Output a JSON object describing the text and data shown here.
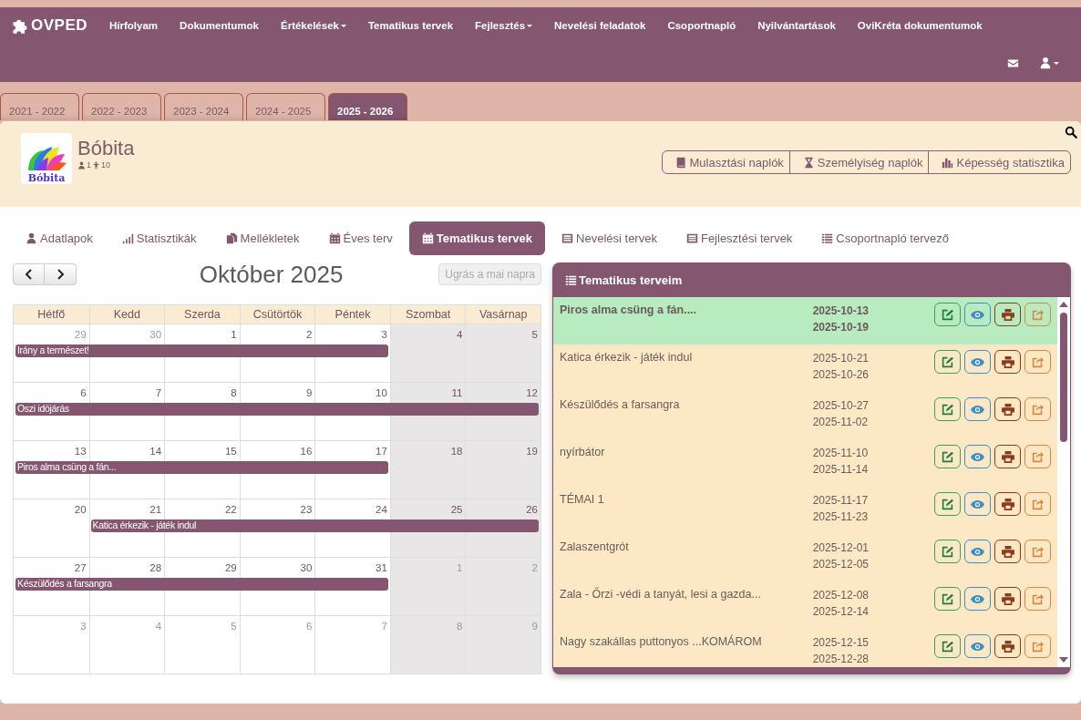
{
  "brand": "OVPED",
  "nav": [
    {
      "label": "Hírfolyam",
      "dropdown": false
    },
    {
      "label": "Dokumentumok",
      "dropdown": false
    },
    {
      "label": "Értékelések",
      "dropdown": true
    },
    {
      "label": "Tematikus tervek",
      "dropdown": false
    },
    {
      "label": "Fejlesztés",
      "dropdown": true
    },
    {
      "label": "Nevelési feladatok",
      "dropdown": false
    },
    {
      "label": "Csoportnapló",
      "dropdown": false
    },
    {
      "label": "Nyilvántartások",
      "dropdown": false
    },
    {
      "label": "OviKréta dokumentumok",
      "dropdown": false
    }
  ],
  "years": [
    {
      "label": "2021 - 2022",
      "selected": false
    },
    {
      "label": "2022 - 2023",
      "selected": false
    },
    {
      "label": "2023 - 2024",
      "selected": false
    },
    {
      "label": "2024 - 2025",
      "selected": false
    },
    {
      "label": "2025 - 2026",
      "selected": true
    }
  ],
  "group": {
    "name": "Bóbita",
    "logo_text": "Bóbita",
    "teachers": "1",
    "children": "10"
  },
  "header_buttons": [
    "Mulasztási naplók",
    "Személyiség naplók",
    "Képesség statisztika"
  ],
  "subtabs": [
    {
      "label": "Adatlapok",
      "selected": false
    },
    {
      "label": "Statisztikák",
      "selected": false
    },
    {
      "label": "Mellékletek",
      "selected": false
    },
    {
      "label": "Éves terv",
      "selected": false
    },
    {
      "label": "Tematikus tervek",
      "selected": true
    },
    {
      "label": "Nevelési tervek",
      "selected": false
    },
    {
      "label": "Fejlesztési tervek",
      "selected": false
    },
    {
      "label": "Csoportnapló tervező",
      "selected": false
    }
  ],
  "calendar": {
    "title": "Október 2025",
    "today_button": {
      "label": "Ugrás a mai napra",
      "disabled": true
    },
    "weekdays": [
      "Hétfő",
      "Kedd",
      "Szerda",
      "Csütörtök",
      "Péntek",
      "Szombat",
      "Vasárnap"
    ],
    "weeks": [
      {
        "days": [
          {
            "num": "29",
            "other": true
          },
          {
            "num": "30",
            "other": true
          },
          {
            "num": "1",
            "other": false
          },
          {
            "num": "2",
            "other": false
          },
          {
            "num": "3",
            "other": false
          },
          {
            "num": "4",
            "other": false
          },
          {
            "num": "5",
            "other": false
          }
        ],
        "event": {
          "title": "Irány a természet!"
        }
      },
      {
        "days": [
          {
            "num": "6",
            "other": false
          },
          {
            "num": "7",
            "other": false
          },
          {
            "num": "8",
            "other": false
          },
          {
            "num": "9",
            "other": false
          },
          {
            "num": "10",
            "other": false
          },
          {
            "num": "11",
            "other": false
          },
          {
            "num": "12",
            "other": false
          }
        ],
        "event": {
          "title": "Oszi idöjárás"
        }
      },
      {
        "days": [
          {
            "num": "13",
            "other": false
          },
          {
            "num": "14",
            "other": false
          },
          {
            "num": "15",
            "other": false
          },
          {
            "num": "16",
            "other": false
          },
          {
            "num": "17",
            "other": false
          },
          {
            "num": "18",
            "other": false
          },
          {
            "num": "19",
            "other": false
          }
        ],
        "event": {
          "title": "Piros alma csüng a fán..."
        }
      },
      {
        "days": [
          {
            "num": "20",
            "other": false
          },
          {
            "num": "21",
            "other": false
          },
          {
            "num": "22",
            "other": false
          },
          {
            "num": "23",
            "other": false
          },
          {
            "num": "24",
            "other": false
          },
          {
            "num": "25",
            "other": false
          },
          {
            "num": "26",
            "other": false
          }
        ],
        "event": {
          "title": "Katica érkezik - játék indul"
        }
      },
      {
        "days": [
          {
            "num": "27",
            "other": false
          },
          {
            "num": "28",
            "other": false
          },
          {
            "num": "29",
            "other": false
          },
          {
            "num": "30",
            "other": false
          },
          {
            "num": "31",
            "other": false
          },
          {
            "num": "1",
            "other": true
          },
          {
            "num": "2",
            "other": true
          }
        ],
        "event": {
          "title": "Készülődés a farsangra"
        }
      },
      {
        "days": [
          {
            "num": "3",
            "other": true
          },
          {
            "num": "4",
            "other": true
          },
          {
            "num": "5",
            "other": true
          },
          {
            "num": "6",
            "other": true
          },
          {
            "num": "7",
            "other": true
          },
          {
            "num": "8",
            "other": true
          },
          {
            "num": "9",
            "other": true
          }
        ]
      }
    ]
  },
  "plans": {
    "title": "Tematikus terveim",
    "items": [
      {
        "title": "Piros alma csüng a fán....",
        "start": "2025-10-13",
        "end": "2025-10-19",
        "selected": true
      },
      {
        "title": "Katica érkezik - játék indul",
        "start": "2025-10-21",
        "end": "2025-10-26",
        "selected": false
      },
      {
        "title": "Készülődés a farsangra",
        "start": "2025-10-27",
        "end": "2025-11-02",
        "selected": false
      },
      {
        "title": "nyírbátor",
        "start": "2025-11-10",
        "end": "2025-11-14",
        "selected": false
      },
      {
        "title": "TÉMAI 1",
        "start": "2025-11-17",
        "end": "2025-11-23",
        "selected": false
      },
      {
        "title": "Zalaszentgrót",
        "start": "2025-12-01",
        "end": "2025-12-05",
        "selected": false
      },
      {
        "title": "Zala - Őrzi -védi a tanyát, lesi a gazda...",
        "start": "2025-12-08",
        "end": "2025-12-14",
        "selected": false
      },
      {
        "title": "Nagy szakállas puttonyos ...KOMÁROM",
        "start": "2025-12-15",
        "end": "2025-12-28",
        "selected": false
      }
    ]
  }
}
